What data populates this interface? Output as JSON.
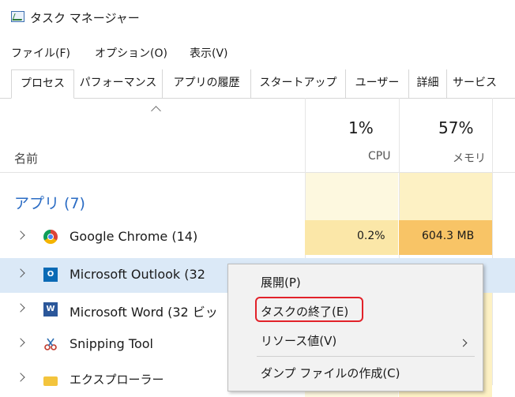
{
  "window": {
    "title": "タスク マネージャー"
  },
  "menu": [
    "ファイル(F)",
    "オプション(O)",
    "表示(V)"
  ],
  "tabs": [
    "プロセス",
    "パフォーマンス",
    "アプリの履歴",
    "スタートアップ",
    "ユーザー",
    "詳細",
    "サービス"
  ],
  "columns": {
    "name": "名前",
    "cpu": {
      "percent": "1%",
      "label": "CPU"
    },
    "memory": {
      "percent": "57%",
      "label": "メモリ"
    }
  },
  "group": {
    "label": "アプリ (7)"
  },
  "rows": [
    {
      "name": "Google Chrome (14)",
      "icon": "chrome-icon",
      "cpu": "0.2%",
      "memory": "604.3 MB"
    },
    {
      "name": "Microsoft Outlook (32",
      "icon": "outlook-icon",
      "cpu": "",
      "memory": ""
    },
    {
      "name": "Microsoft Word (32 ビッ",
      "icon": "word-icon",
      "cpu": "",
      "memory": ""
    },
    {
      "name": "Snipping Tool",
      "icon": "snipping-tool-icon",
      "cpu": "",
      "memory": ""
    },
    {
      "name": "エクスプローラー",
      "icon": "explorer-icon",
      "cpu": "",
      "memory": ""
    }
  ],
  "context_menu": {
    "items": [
      "展開(P)",
      "タスクの終了(E)",
      "リソース値(V)",
      "ダンプ ファイルの作成(C)"
    ],
    "highlighted": "タスクの終了(E)"
  },
  "colors": {
    "highlight_outline": "#e2222a",
    "cpu_heat": "#fdf4c9",
    "memory_heat": "#fbd98c",
    "selected_row": "#dbe9f7",
    "group_label": "#2b6cc4"
  }
}
